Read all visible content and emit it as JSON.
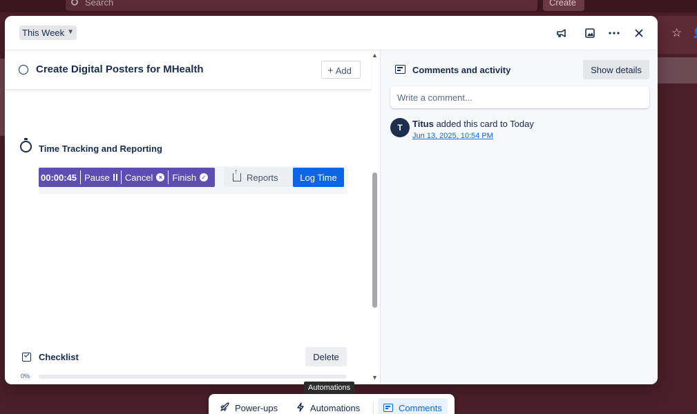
{
  "background": {
    "search_placeholder": "Search",
    "create_label": "Create"
  },
  "modal": {
    "list_name": "This Week",
    "header_icons": [
      "megaphone-icon",
      "image-icon",
      "more-icon",
      "close-icon"
    ]
  },
  "card": {
    "title": "Create Digital Posters for MHealth",
    "add_label": "Add"
  },
  "time_tracking": {
    "title": "Time Tracking and Reporting",
    "timer_value": "00:00:45",
    "pause_label": "Pause",
    "cancel_label": "Cancel",
    "finish_label": "Finish",
    "reports_label": "Reports",
    "log_time_label": "Log Time"
  },
  "checklist": {
    "title": "Checklist",
    "delete_label": "Delete",
    "progress_text": "0%",
    "progress_fraction": 0
  },
  "comments": {
    "title": "Comments and activity",
    "show_details_label": "Show details",
    "input_placeholder": "Write a comment...",
    "activity": {
      "avatar_initial": "T",
      "user": "Titus",
      "action": "added this card to Today",
      "timestamp": "Jun 13, 2025, 10:54 PM"
    }
  },
  "toolbar": {
    "tooltip": "Automations",
    "powerups_label": "Power-ups",
    "automations_label": "Automations",
    "comments_label": "Comments"
  },
  "colors": {
    "accent": "#0c66e4",
    "timer_bg": "#5e4db2",
    "board_bg": "#4a1f2a"
  }
}
